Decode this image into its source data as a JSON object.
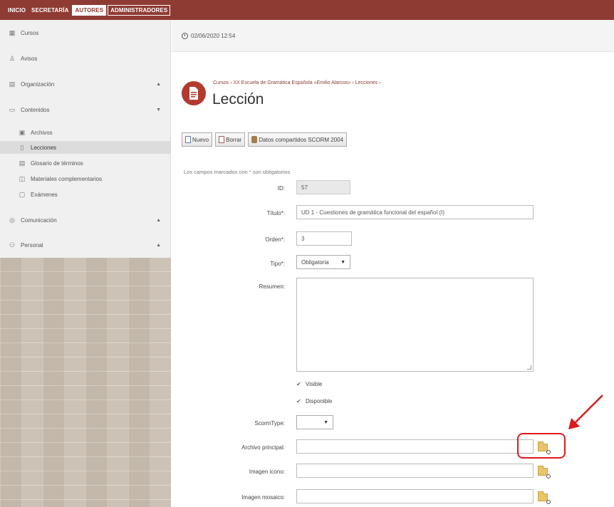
{
  "topnav": {
    "tabs": [
      {
        "label": "INICIO"
      },
      {
        "label": "SECRETARÍA"
      },
      {
        "label": "AUTORES"
      },
      {
        "label": "ADMINISTRADORES"
      }
    ]
  },
  "sidebar": {
    "items": [
      {
        "label": "Cursos",
        "icon": "list-icon"
      },
      {
        "label": "Avisos",
        "icon": "bell-icon"
      },
      {
        "label": "Organización",
        "icon": "list-icon"
      },
      {
        "label": "Contenidos",
        "icon": "book-icon"
      },
      {
        "label": "Archivos",
        "icon": "drive-icon"
      },
      {
        "label": "Lecciones",
        "icon": "document-icon"
      },
      {
        "label": "Glosario de términos",
        "icon": "glossary-icon"
      },
      {
        "label": "Materiales complementarios",
        "icon": "attachment-icon"
      },
      {
        "label": "Exámenes",
        "icon": "exam-icon"
      },
      {
        "label": "Comunicación",
        "icon": "comment-icon"
      },
      {
        "label": "Personal",
        "icon": "people-icon"
      }
    ]
  },
  "datebar": {
    "datetime": "02/06/2020 12:54"
  },
  "header": {
    "breadcrumb": "Cursos › XX Escuela de Gramática Española «Emilio Alarcos» › Lecciones ›",
    "title": "Lección"
  },
  "toolbar": {
    "new_label": "Nuevo",
    "delete_label": "Borrar",
    "scorm_label": "Datos compartidos SCORM 2004"
  },
  "form": {
    "required_note": "Los campos marcados con * son obligatorios",
    "id_label": "ID:",
    "id_value": "57",
    "title_label": "Título*:",
    "title_value": "UD 1 - Cuestiones de gramática funcional del español (I)",
    "order_label": "Orden*:",
    "order_value": "3",
    "type_label": "Tipo*:",
    "type_value": "Obligatoria",
    "summary_label": "Resumen:",
    "summary_value": "",
    "visible_label": "Visible",
    "available_label": "Disponible",
    "scormtype_label": "ScormType:",
    "scormtype_value": "",
    "main_file_label": "Archivo principal:",
    "main_file_value": "",
    "icon_image_label": "Imagen icono:",
    "icon_image_value": "",
    "mosaic_image_label": "Imagen mosaico:",
    "mosaic_image_value": ""
  },
  "colors": {
    "brand": "#8e3b33",
    "accent_icon": "#b23a2e",
    "highlight": "#e0191b"
  }
}
